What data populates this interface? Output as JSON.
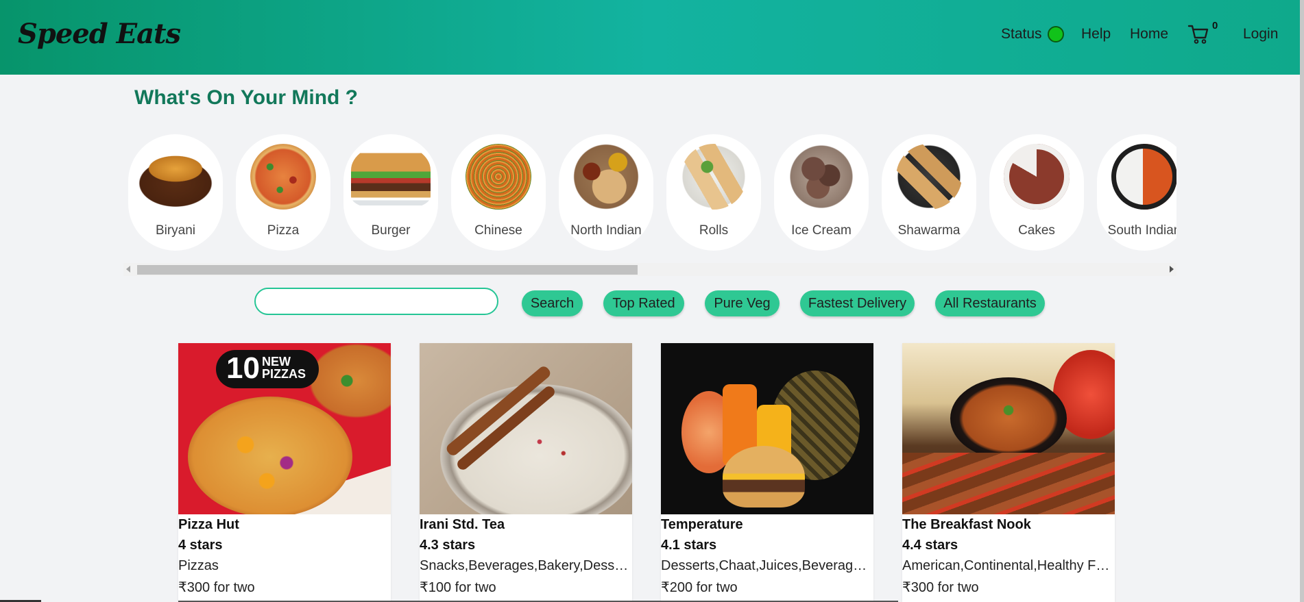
{
  "brand": {
    "logo": "Speed Eats"
  },
  "nav": {
    "status_label": "Status",
    "help": "Help",
    "home": "Home",
    "cart_count": "0",
    "login": "Login"
  },
  "section_title": "What's On Your Mind ?",
  "categories": [
    {
      "label": "Biryani"
    },
    {
      "label": "Pizza"
    },
    {
      "label": "Burger"
    },
    {
      "label": "Chinese"
    },
    {
      "label": "North Indian"
    },
    {
      "label": "Rolls"
    },
    {
      "label": "Ice Cream"
    },
    {
      "label": "Shawarma"
    },
    {
      "label": "Cakes"
    },
    {
      "label": "South Indian"
    }
  ],
  "search": {
    "value": "",
    "placeholder": ""
  },
  "filters": {
    "search": "Search",
    "top_rated": "Top Rated",
    "pure_veg": "Pure Veg",
    "fastest_delivery": "Fastest Delivery",
    "all_restaurants": "All Restaurants"
  },
  "restaurants": [
    {
      "name": "Pizza Hut",
      "rating": "4 stars",
      "cuisine": "Pizzas",
      "price": "₹300 for two",
      "banner": "10",
      "banner_sub1": "NEW",
      "banner_sub2": "PIZZAS"
    },
    {
      "name": "Irani Std. Tea",
      "rating": "4.3 stars",
      "cuisine": "Snacks,Beverages,Bakery,Desserts,Tea",
      "price": "₹100 for two"
    },
    {
      "name": "Temperature",
      "rating": "4.1 stars",
      "cuisine": "Desserts,Chaat,Juices,Beverages,Snacks",
      "price": "₹200 for two"
    },
    {
      "name": "The Breakfast Nook",
      "rating": "4.4 stars",
      "cuisine": "American,Continental,Healthy Food",
      "price": "₹300 for two"
    }
  ],
  "colors": {
    "accent": "#2fc893",
    "header_start": "#07946b",
    "header_mid": "#13b3a0",
    "title": "#12785a",
    "status_on": "#11c21a"
  },
  "icons": {
    "status": "status-dot-icon",
    "cart": "cart-icon"
  }
}
